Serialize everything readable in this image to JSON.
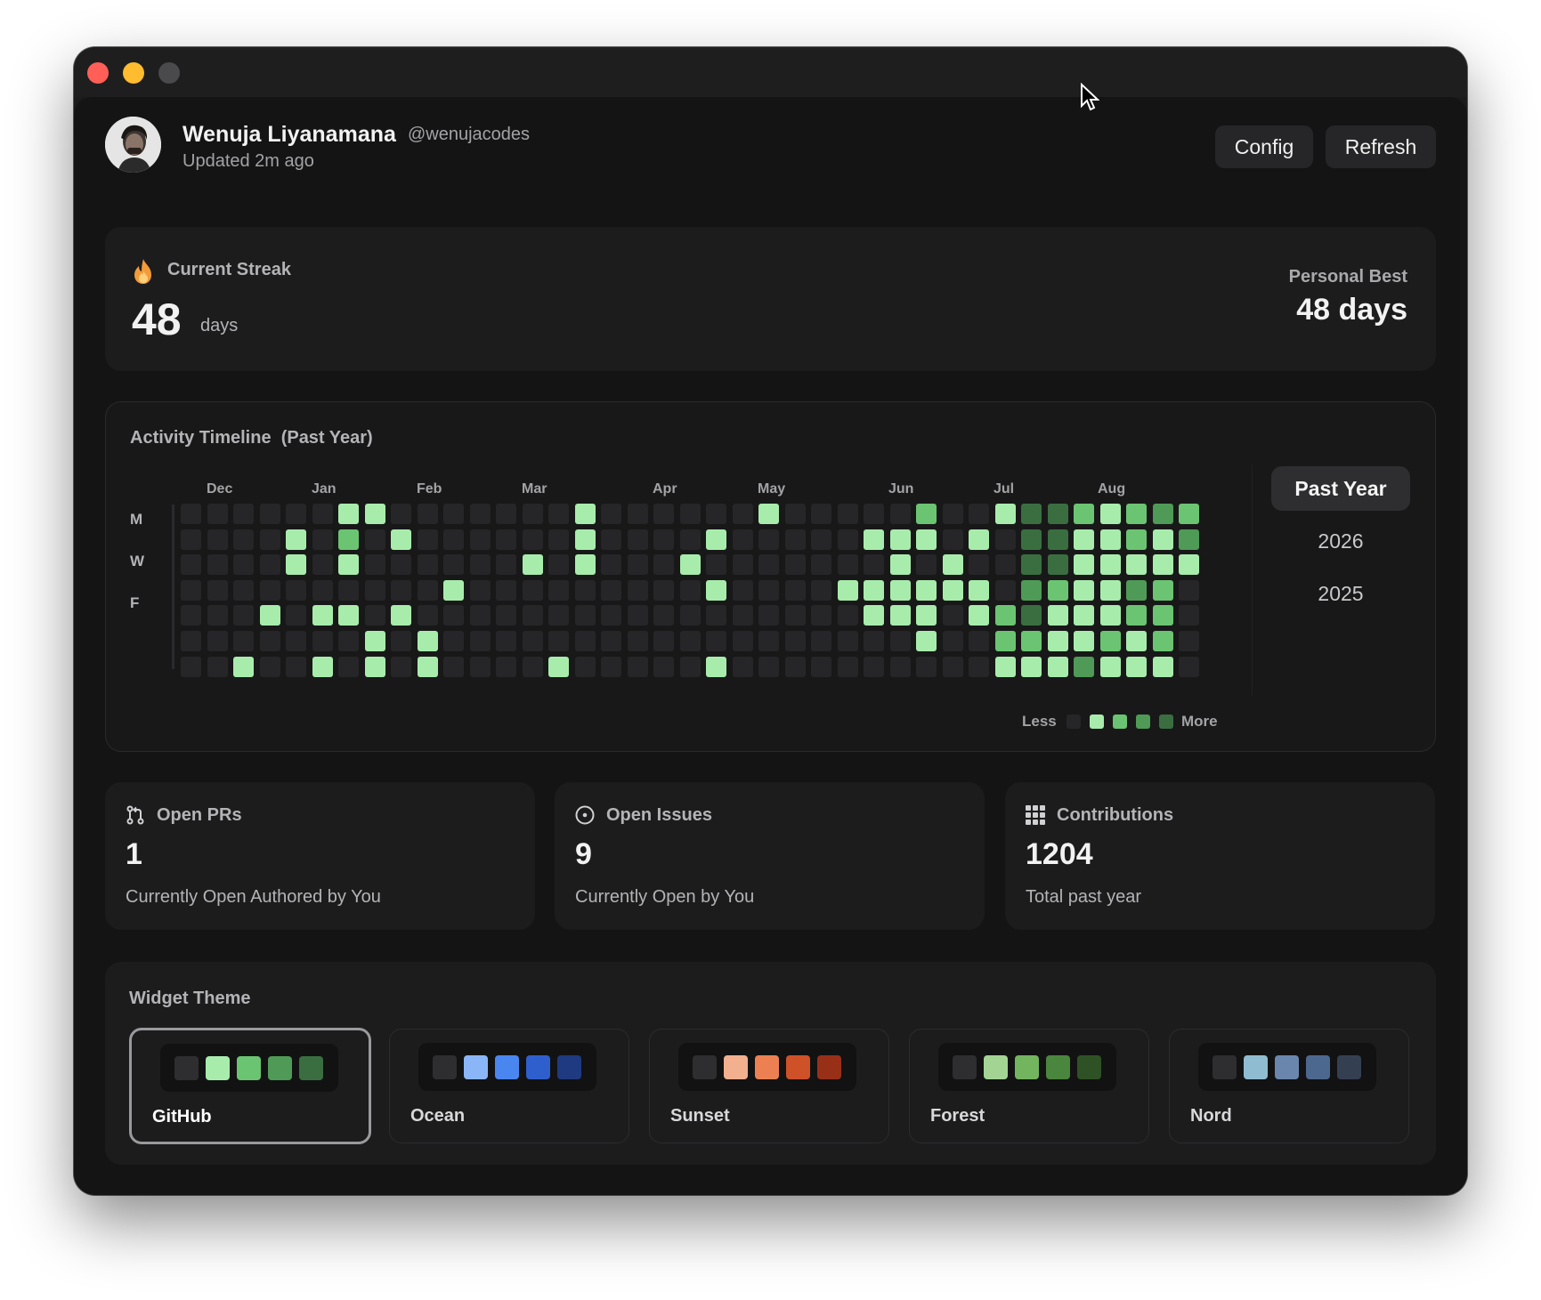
{
  "user": {
    "name": "Wenuja Liyanamana",
    "handle": "@wenujacodes",
    "updated": "Updated 2m ago"
  },
  "header": {
    "config_label": "Config",
    "refresh_label": "Refresh"
  },
  "streak": {
    "label": "Current Streak",
    "value": "48",
    "unit": "days",
    "best_label": "Personal Best",
    "best_value": "48 days",
    "icon": "flame-icon"
  },
  "activity": {
    "title": "Activity Timeline  (Past Year)",
    "months": [
      "Dec",
      "Jan",
      "Feb",
      "Mar",
      "Apr",
      "May",
      "Jun",
      "Jul",
      "Aug"
    ],
    "day_labels": [
      "M",
      "W",
      "F"
    ],
    "legend_less": "Less",
    "legend_more": "More",
    "ranges": [
      "Past Year",
      "2026",
      "2025"
    ],
    "active_range": "Past Year",
    "level_colors": [
      "#262628",
      "#a8ecac",
      "#6bc471",
      "#4f9a56",
      "#3a6e40"
    ],
    "weeks": [
      [
        0,
        0,
        0,
        0,
        0,
        0,
        0
      ],
      [
        0,
        0,
        0,
        0,
        0,
        0,
        0
      ],
      [
        0,
        0,
        0,
        0,
        0,
        0,
        1
      ],
      [
        0,
        0,
        0,
        0,
        1,
        0,
        0
      ],
      [
        0,
        1,
        1,
        0,
        0,
        0,
        0
      ],
      [
        0,
        0,
        0,
        0,
        1,
        0,
        1
      ],
      [
        1,
        2,
        1,
        0,
        1,
        0,
        0
      ],
      [
        1,
        0,
        0,
        0,
        0,
        1,
        1
      ],
      [
        0,
        1,
        0,
        0,
        1,
        0,
        0
      ],
      [
        0,
        0,
        0,
        0,
        0,
        1,
        1
      ],
      [
        0,
        0,
        0,
        1,
        0,
        0,
        0
      ],
      [
        0,
        0,
        0,
        0,
        0,
        0,
        0
      ],
      [
        0,
        0,
        0,
        0,
        0,
        0,
        0
      ],
      [
        0,
        0,
        1,
        0,
        0,
        0,
        0
      ],
      [
        0,
        0,
        0,
        0,
        0,
        0,
        1
      ],
      [
        1,
        1,
        1,
        0,
        0,
        0,
        0
      ],
      [
        0,
        0,
        0,
        0,
        0,
        0,
        0
      ],
      [
        0,
        0,
        0,
        0,
        0,
        0,
        0
      ],
      [
        0,
        0,
        0,
        0,
        0,
        0,
        0
      ],
      [
        0,
        0,
        1,
        0,
        0,
        0,
        0
      ],
      [
        0,
        1,
        0,
        1,
        0,
        0,
        1
      ],
      [
        0,
        0,
        0,
        0,
        0,
        0,
        0
      ],
      [
        1,
        0,
        0,
        0,
        0,
        0,
        0
      ],
      [
        0,
        0,
        0,
        0,
        0,
        0,
        0
      ],
      [
        0,
        0,
        0,
        0,
        0,
        0,
        0
      ],
      [
        0,
        0,
        0,
        1,
        0,
        0,
        0
      ],
      [
        0,
        1,
        0,
        1,
        1,
        0,
        0
      ],
      [
        0,
        1,
        1,
        1,
        1,
        0,
        0
      ],
      [
        2,
        1,
        0,
        1,
        1,
        1,
        0
      ],
      [
        0,
        0,
        1,
        1,
        0,
        0,
        0
      ],
      [
        0,
        1,
        0,
        1,
        1,
        0,
        0
      ],
      [
        1,
        0,
        0,
        0,
        2,
        2,
        1
      ],
      [
        4,
        4,
        4,
        3,
        4,
        2,
        1
      ],
      [
        4,
        4,
        4,
        2,
        1,
        1,
        1
      ],
      [
        2,
        1,
        1,
        1,
        1,
        1,
        3
      ],
      [
        1,
        1,
        1,
        1,
        1,
        2,
        1
      ],
      [
        2,
        2,
        1,
        3,
        2,
        1,
        1
      ],
      [
        3,
        1,
        1,
        2,
        2,
        2,
        1
      ],
      [
        2,
        3,
        1,
        0,
        0,
        0,
        0
      ]
    ]
  },
  "stats": [
    {
      "label": "Open PRs",
      "value": "1",
      "sub": "Currently Open Authored by You",
      "icon": "pull-request-icon"
    },
    {
      "label": "Open Issues",
      "value": "9",
      "sub": "Currently Open by You",
      "icon": "issue-icon"
    },
    {
      "label": "Contributions",
      "value": "1204",
      "sub": "Total past year",
      "icon": "grid-icon"
    }
  ],
  "themes": {
    "title": "Widget Theme",
    "selected": "GitHub",
    "options": [
      {
        "name": "GitHub",
        "colors": [
          "#2e2e30",
          "#a8ecac",
          "#6bc471",
          "#4f9a56",
          "#3a6e40"
        ]
      },
      {
        "name": "Ocean",
        "colors": [
          "#2e2e30",
          "#8ab6f7",
          "#4a86f0",
          "#2f5fcc",
          "#1f3a80"
        ]
      },
      {
        "name": "Sunset",
        "colors": [
          "#2e2e30",
          "#f2b08e",
          "#ec8052",
          "#cf5128",
          "#983018"
        ]
      },
      {
        "name": "Forest",
        "colors": [
          "#2e2e30",
          "#a3d493",
          "#72b55e",
          "#4a863d",
          "#2e5225"
        ]
      },
      {
        "name": "Nord",
        "colors": [
          "#2e2e30",
          "#8fbcd0",
          "#6a86ad",
          "#4d688f",
          "#353f52"
        ]
      }
    ]
  }
}
